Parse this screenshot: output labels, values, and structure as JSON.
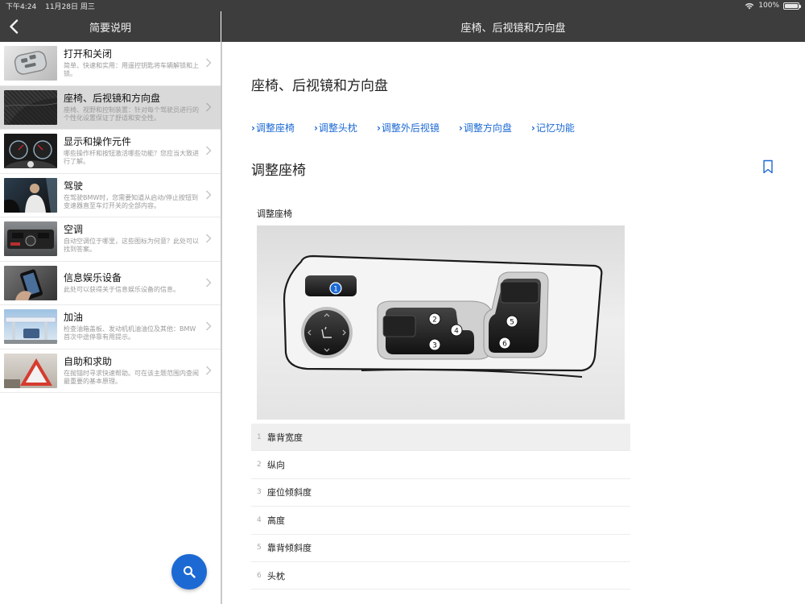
{
  "status": {
    "time": "下午4:24",
    "date": "11月28日 周三",
    "battery": "100%",
    "battery_level": 1.0
  },
  "nav": {
    "left_title": "简要说明",
    "right_title": "座椅、后视镜和方向盘"
  },
  "sidebar": {
    "items": [
      {
        "title": "打开和关闭",
        "desc": "简单、快速和实用：用遥控钥匙将车辆解锁和上锁。"
      },
      {
        "title": "座椅、后视镜和方向盘",
        "desc": "座椅、视野和控制装置：针对每个驾驶员进行的个性化设置保证了舒适和安全性。"
      },
      {
        "title": "显示和操作元件",
        "desc": "哪些操作杆和按钮激活哪些功能？您应当大致进行了解。"
      },
      {
        "title": "驾驶",
        "desc": "在驾驶BMW时，您需要知道从启动/停止按钮到变速器直至车灯开关的全部内容。"
      },
      {
        "title": "空调",
        "desc": "自动空调位于哪里，这些图标为何意？此处可以找到答案。"
      },
      {
        "title": "信息娱乐设备",
        "desc": "此处可以获得关于信息娱乐设备的信息。"
      },
      {
        "title": "加油",
        "desc": "检查油箱盖板、发动机机油油位及其他：BMW首次中途停靠有用提示。"
      },
      {
        "title": "自助和求助",
        "desc": "在抛锚时寻求快速帮助。可在该主题范围内查阅最重要的基本原理。"
      }
    ]
  },
  "content": {
    "page_title": "座椅、后视镜和方向盘",
    "links": [
      "调整座椅",
      "调整头枕",
      "调整外后视镜",
      "调整方向盘",
      "记忆功能"
    ],
    "section_title": "调整座椅",
    "figure_label": "调整座椅",
    "figure_numbers": [
      "1",
      "2",
      "3",
      "4",
      "5",
      "6"
    ],
    "legend": [
      {
        "num": "1",
        "label": "靠背宽度"
      },
      {
        "num": "2",
        "label": "纵向"
      },
      {
        "num": "3",
        "label": "座位倾斜度"
      },
      {
        "num": "4",
        "label": "高度"
      },
      {
        "num": "5",
        "label": "靠背倾斜度"
      },
      {
        "num": "6",
        "label": "头枕"
      }
    ]
  },
  "colors": {
    "accent": "#1c69d4",
    "bar": "#3d3d3d",
    "active_row": "#d9d9d9"
  },
  "icons": {
    "back": "chevron-left-icon",
    "search": "search-icon",
    "bookmark": "bookmark-icon",
    "wifi": "wifi-icon",
    "battery": "battery-icon"
  }
}
